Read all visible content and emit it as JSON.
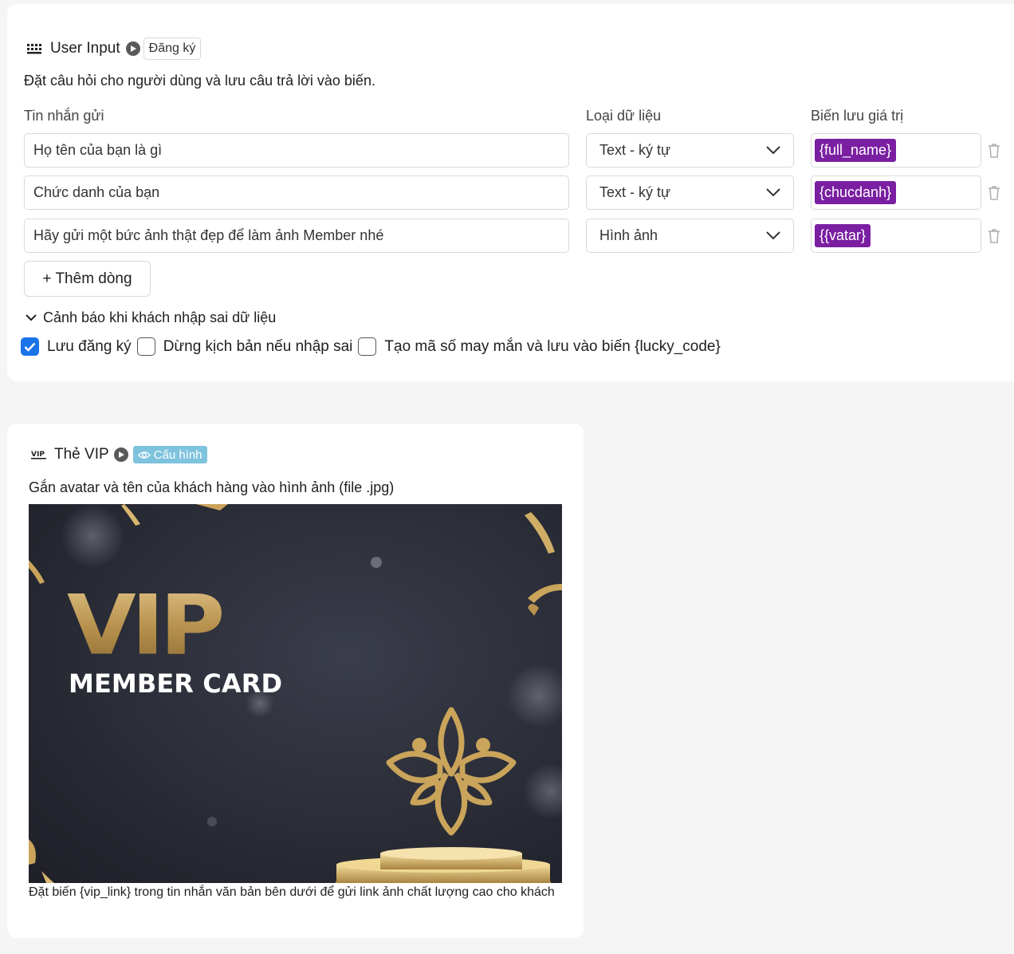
{
  "user_input": {
    "title": "User Input",
    "tag": "Đăng ký",
    "description": "Đặt câu hỏi cho người dùng và lưu câu trả lời vào biến.",
    "columns": {
      "message": "Tin nhắn gửi",
      "data_type": "Loại dữ liệu",
      "variable": "Biến lưu giá trị"
    },
    "rows": [
      {
        "message": "Họ tên của bạn là gì",
        "data_type": "Text - ký tự",
        "variable": "{full_name}"
      },
      {
        "message": "Chức danh của bạn",
        "data_type": "Text - ký tự",
        "variable": "{chucdanh}"
      },
      {
        "message": "Hãy gửi một bức ảnh thật đẹp để làm ảnh Member nhé",
        "data_type": "Hình ảnh",
        "variable": "{{vatar}"
      }
    ],
    "add_row_label": "+ Thêm dòng",
    "collapse_label": "Cảnh báo khi khách nhập sai dữ liệu",
    "options": [
      {
        "label": "Lưu đăng ký",
        "checked": true
      },
      {
        "label": "Dừng kịch bản nếu nhập sai",
        "checked": false
      },
      {
        "label": "Tạo mã số may mắn và lưu vào biến {lucky_code}",
        "checked": false
      }
    ]
  },
  "vip_card": {
    "title": "Thẻ VIP",
    "tag": "Cấu hình",
    "description": "Gắn avatar và tên của khách hàng vào hình ảnh (file .jpg)",
    "image": {
      "big_text": "VIP",
      "sub_text": "MEMBER CARD"
    },
    "caption": "Đặt biến {vip_link} trong tin nhắn văn bản bên dưới để gửi link ảnh chất lượng cao cho khách"
  },
  "colors": {
    "variable_chip": "#7a1fa2",
    "checkbox_checked": "#1a73e8",
    "config_tag": "#7ec3de",
    "gold": "#c9a45a"
  }
}
